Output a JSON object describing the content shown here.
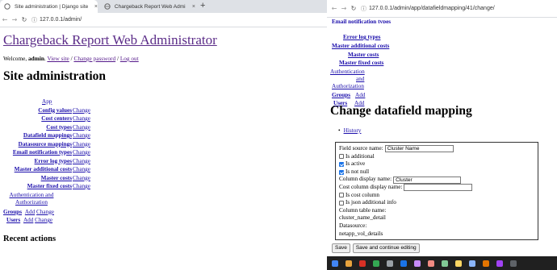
{
  "left_window": {
    "tabs": [
      {
        "title": "Site administration | Django site",
        "close": "×"
      },
      {
        "title": "Chargeback Report Web Admi",
        "close": "×"
      }
    ],
    "new_tab": "+",
    "url": "127.0.0.1/admin/",
    "branding": "Chargeback Report Web Administrator",
    "welcome": "Welcome,",
    "user": "admin",
    "view_site": "View site",
    "sep": "/",
    "change_password": "Change password",
    "log_out": "Log out",
    "page_title": "Site administration",
    "app_label": "App",
    "models": [
      {
        "name": "Config values",
        "change": "Change"
      },
      {
        "name": "Cost centers",
        "change": "Change"
      },
      {
        "name": "Cost types",
        "change": "Change"
      },
      {
        "name": "Datafield mappings",
        "change": "Change"
      },
      {
        "name": "Datasource mappings",
        "change": "Change"
      },
      {
        "name": "Email notification types",
        "change": "Change"
      },
      {
        "name": "Error log types",
        "change": "Change"
      },
      {
        "name": "Master additional costs",
        "change": "Change"
      },
      {
        "name": "Master costs",
        "change": "Change"
      },
      {
        "name": "Master fixed costs",
        "change": "Change"
      }
    ],
    "auth_app": "Authentication and Authorization",
    "groups": {
      "name": "Groups",
      "add": "Add",
      "change": "Change"
    },
    "users": {
      "name": "Users",
      "add": "Add",
      "change": "Change"
    },
    "recent_actions": "Recent actions"
  },
  "right_window": {
    "url": "127.0.0.1/admin/app/datafieldmapping/41/change/",
    "cut_link": "Email notification types",
    "links": [
      "Error log types",
      "Master additional costs",
      "Master costs",
      "Master fixed costs"
    ],
    "auth_app": [
      "Authentication",
      "and",
      "Authorization"
    ],
    "groups": {
      "name": "Groups",
      "add": "Add"
    },
    "users": {
      "name": "Users",
      "add": "Add"
    },
    "page_title": "Change datafield mapping",
    "history": "History",
    "form": {
      "field_source_name_label": "Field source name:",
      "field_source_name_value": "Cluster Name",
      "is_additional": "Is additional",
      "is_active": "Is active",
      "is_not_null": "Is not null",
      "column_display_name_label": "Column display name:",
      "column_display_name_value": "Cluster",
      "cost_column_display_name_label": "Cost column display name:",
      "is_cost_column": "Is cost column",
      "is_json_additional_info": "Is json additional info",
      "column_table_name_label": "Column table name:",
      "column_table_name_value": "cluster_name_detail",
      "datasource_label": "Datasource:",
      "datasource_value": "netapp_vol_details"
    },
    "save": "Save",
    "save_continue": "Save and continue editing"
  }
}
